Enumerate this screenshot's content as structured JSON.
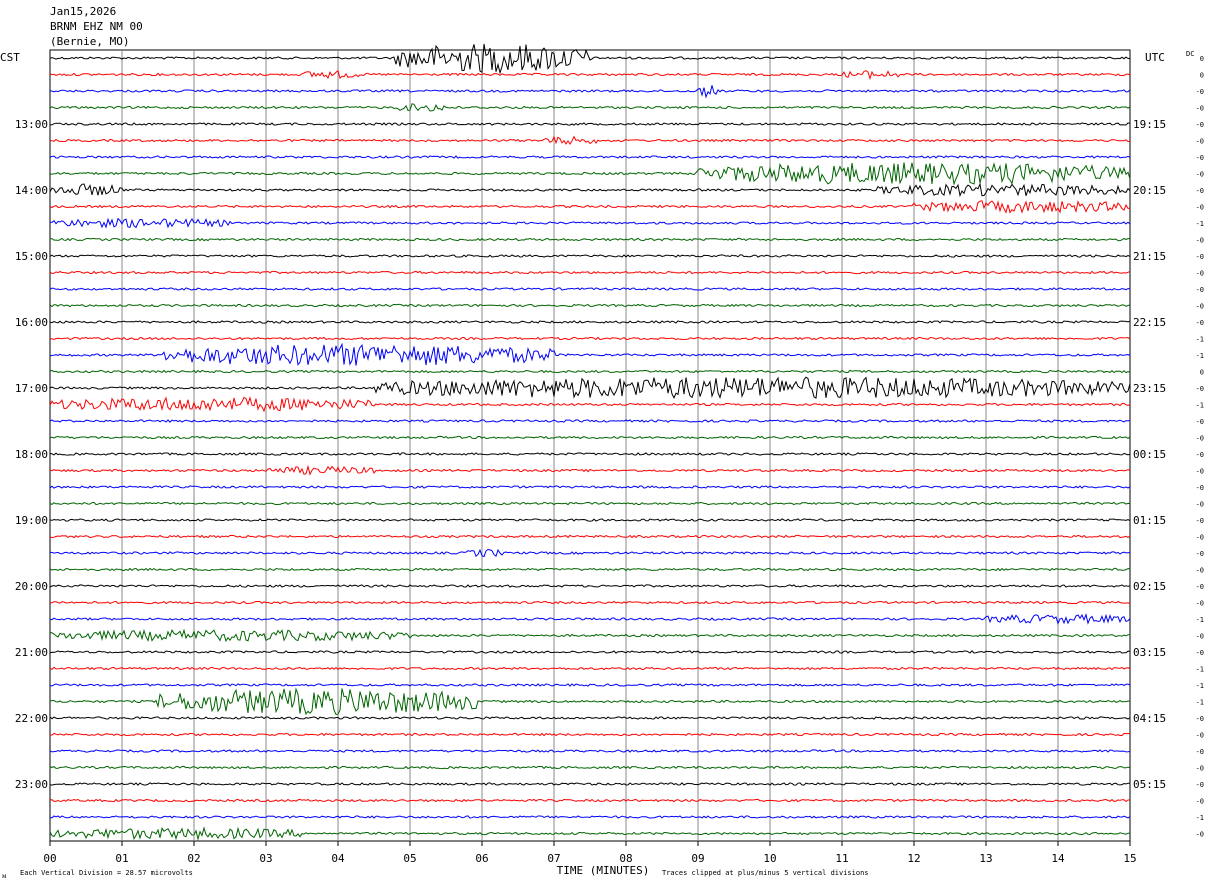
{
  "header": {
    "date": "Jan15,2026",
    "station": "BRNM EHZ NM 00",
    "location": "(Bernie, MO)"
  },
  "left_tz": "CST",
  "right_tz": "UTC",
  "dc_label": "DC",
  "footer": {
    "scale_note": "Each Vertical Division =   28.57 microvolts",
    "clip_note": "Traces clipped at plus/minus 5 vertical divisions",
    "logo_mark": "ᴍ"
  },
  "chart_data": {
    "type": "line",
    "title": "BRNM EHZ NM 00",
    "xlabel": "TIME (MINUTES)",
    "x_ticks": [
      "00",
      "01",
      "02",
      "03",
      "04",
      "05",
      "06",
      "07",
      "08",
      "09",
      "10",
      "11",
      "12",
      "13",
      "14",
      "15"
    ],
    "xlim": [
      0,
      15
    ],
    "row_minutes": 15,
    "left_hour_labels": [
      "13:00",
      "14:00",
      "15:00",
      "16:00",
      "17:00",
      "18:00",
      "19:00",
      "20:00",
      "21:00",
      "22:00",
      "23:00"
    ],
    "right_hour_labels": [
      "19:15",
      "20:15",
      "21:15",
      "22:15",
      "23:15",
      "00:15",
      "01:15",
      "02:15",
      "03:15",
      "04:15",
      "05:15"
    ],
    "trace_colors": [
      "#000000",
      "#ff0000",
      "#0000ff",
      "#006400"
    ],
    "dc_offsets": [
      "0",
      "0",
      "-0",
      "-0",
      "-0",
      "-0",
      "-0",
      "-0",
      "-0",
      "-0",
      "-1",
      "-0",
      "-0",
      "-0",
      "-0",
      "-0",
      "-0",
      "-1",
      "-1",
      "0",
      "-0",
      "-1",
      "-0",
      "-0",
      "-0",
      "-0",
      "-0",
      "-0",
      "-0",
      "-0",
      "-0",
      "-0",
      "-0",
      "-0",
      "-1",
      "-0",
      "-0",
      "-1",
      "-1",
      "-1",
      "-0",
      "-0",
      "-0",
      "-0",
      "-0",
      "-0",
      "-1",
      "-0"
    ],
    "events": [
      {
        "trace": 0,
        "t_start": 4.8,
        "t_end": 7.5,
        "amplitude": 1.4
      },
      {
        "trace": 1,
        "t_start": 3.5,
        "t_end": 4.3,
        "amplitude": 0.3
      },
      {
        "trace": 1,
        "t_start": 11.0,
        "t_end": 11.8,
        "amplitude": 0.3
      },
      {
        "trace": 2,
        "t_start": 9.0,
        "t_end": 9.3,
        "amplitude": 0.5
      },
      {
        "trace": 3,
        "t_start": 4.8,
        "t_end": 5.6,
        "amplitude": 0.3
      },
      {
        "trace": 5,
        "t_start": 6.8,
        "t_end": 7.6,
        "amplitude": 0.3
      },
      {
        "trace": 7,
        "t_start": 9.0,
        "t_end": 15.0,
        "amplitude": 1.0
      },
      {
        "trace": 8,
        "t_start": 0.0,
        "t_end": 1.0,
        "amplitude": 0.5
      },
      {
        "trace": 8,
        "t_start": 11.5,
        "t_end": 15.0,
        "amplitude": 0.5
      },
      {
        "trace": 9,
        "t_start": 12.0,
        "t_end": 15.0,
        "amplitude": 0.5
      },
      {
        "trace": 10,
        "t_start": 0.0,
        "t_end": 2.5,
        "amplitude": 0.35
      },
      {
        "trace": 18,
        "t_start": 1.5,
        "t_end": 7.0,
        "amplitude": 1.0
      },
      {
        "trace": 20,
        "t_start": 4.5,
        "t_end": 15.0,
        "amplitude": 1.0
      },
      {
        "trace": 21,
        "t_start": 0.0,
        "t_end": 4.5,
        "amplitude": 0.6
      },
      {
        "trace": 25,
        "t_start": 3.0,
        "t_end": 4.5,
        "amplitude": 0.3
      },
      {
        "trace": 30,
        "t_start": 5.8,
        "t_end": 6.3,
        "amplitude": 0.3
      },
      {
        "trace": 34,
        "t_start": 13.0,
        "t_end": 15.0,
        "amplitude": 0.35
      },
      {
        "trace": 35,
        "t_start": 0.0,
        "t_end": 5.0,
        "amplitude": 0.45
      },
      {
        "trace": 39,
        "t_start": 1.5,
        "t_end": 6.0,
        "amplitude": 1.2
      },
      {
        "trace": 47,
        "t_start": 0.0,
        "t_end": 3.5,
        "amplitude": 0.45
      }
    ]
  }
}
